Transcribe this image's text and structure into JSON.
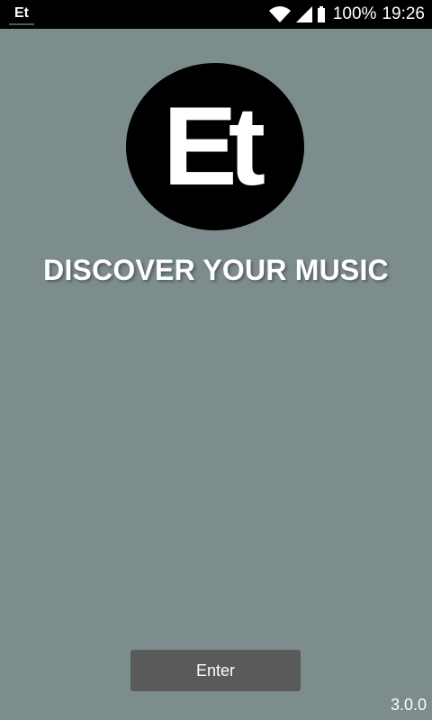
{
  "status_bar": {
    "app_icon_text": "Et",
    "battery": "100%",
    "time": "19:26",
    "icons": [
      "wifi-icon",
      "signal-icon",
      "battery-icon"
    ]
  },
  "logo": {
    "text": "Et",
    "icon_name": "et-logo"
  },
  "headline": "DISCOVER YOUR MUSIC",
  "enter_button": {
    "label": "Enter"
  },
  "version": "3.0.0",
  "colors": {
    "background": "#7d8c8c",
    "status_bar": "#000000",
    "logo_circle": "#000000",
    "button": "#5a5a5a",
    "text": "#ffffff"
  }
}
